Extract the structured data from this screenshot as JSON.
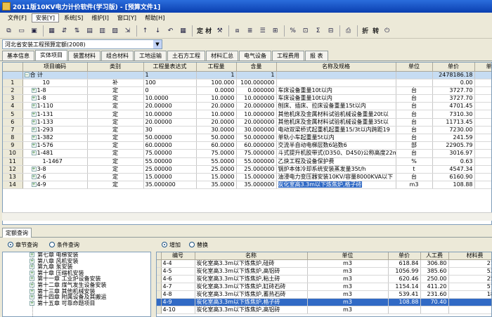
{
  "window": {
    "title": "2011版10KV电力计价软件(学习版) - [预算文件1]"
  },
  "menu": [
    "文件[F]",
    "安装[Y]",
    "系统[S]",
    "维护[I]",
    "窗口[Y]",
    "帮助[H]"
  ],
  "toolbar": {
    "text1": "定 材",
    "text2": "折",
    "text3": "转"
  },
  "quota_select": {
    "value": "河北省安装工程预算定额(2008)"
  },
  "tabs": [
    "基本信息",
    "实体项目",
    "装置材料",
    "组合材料",
    "工地运输",
    "土石方工程",
    "材料汇总",
    "电气设备",
    "工程费用",
    "报 表"
  ],
  "grid": {
    "headers": [
      "",
      "项目编码",
      "类别",
      "工程量表达式",
      "工程量",
      "含量",
      "名称及规格",
      "单位",
      "单价",
      "单价"
    ],
    "total": {
      "code": "合 计",
      "expr": "1",
      "qty": "1",
      "content": "1",
      "price": "2478186.18"
    },
    "rows": [
      {
        "n": "1",
        "tree": false,
        "code": "10",
        "type": "补",
        "expr": "100",
        "qty": "100.000",
        "content": "100.000000",
        "name": "",
        "unit": "",
        "price": "0.00"
      },
      {
        "n": "2",
        "tree": true,
        "code": "1-8",
        "type": "定",
        "expr": "0",
        "qty": "0.0000",
        "content": "0.000000",
        "name": "车床设备重量10t以内",
        "unit": "台",
        "price": "3727.70"
      },
      {
        "n": "3",
        "tree": true,
        "code": "1-8",
        "type": "定",
        "expr": "10.0000",
        "qty": "10.0000",
        "content": "10.000000",
        "name": "车床设备重量10t以内",
        "unit": "台",
        "price": "3727.70"
      },
      {
        "n": "4",
        "tree": true,
        "code": "1-110",
        "type": "定",
        "expr": "20.00000",
        "qty": "20.0000",
        "content": "20.000000",
        "name": "刨床、插床、拉床设备重量15t以内",
        "unit": "台",
        "price": "4701.45"
      },
      {
        "n": "5",
        "tree": true,
        "code": "1-131",
        "type": "定",
        "expr": "10.00000",
        "qty": "10.0000",
        "content": "10.000000",
        "name": "其他机床及金属材料试验机械设备重量20t以",
        "unit": "台",
        "price": "7310.30"
      },
      {
        "n": "6",
        "tree": true,
        "code": "1-133",
        "type": "定",
        "expr": "20.00000",
        "qty": "20.0000",
        "content": "20.000000",
        "name": "其他机床及金属材料试验机械设备重量35t以",
        "unit": "台",
        "price": "11713.45"
      },
      {
        "n": "7",
        "tree": true,
        "code": "1-293",
        "type": "定",
        "expr": "30",
        "qty": "30.0000",
        "content": "30.000000",
        "name": "电动双梁桥式起重机起重量15/3t以内跨距19",
        "unit": "台",
        "price": "7230.00"
      },
      {
        "n": "8",
        "tree": true,
        "code": "1-382",
        "type": "定",
        "expr": "50.00000",
        "qty": "50.0000",
        "content": "50.000000",
        "name": "单轨小车起重量5t以内",
        "unit": "台",
        "price": "241.59"
      },
      {
        "n": "9",
        "tree": true,
        "code": "1-576",
        "type": "定",
        "expr": "60.00000",
        "qty": "60.0000",
        "content": "60.000000",
        "name": "交流半自动电梯层数6站数6",
        "unit": "部",
        "price": "22905.79"
      },
      {
        "n": "10",
        "tree": true,
        "code": "1-481",
        "type": "定",
        "expr": "75.00000",
        "qty": "75.0000",
        "content": "75.000000",
        "name": "斗式提升机胶带式(D350、D450)公称高度22m",
        "unit": "台",
        "price": "3016.97"
      },
      {
        "n": "11",
        "tree": false,
        "code": "1-1467",
        "type": "定",
        "expr": "55.00000",
        "qty": "55.0000",
        "content": "55.000000",
        "name": "乙炔工程及设备保护费",
        "unit": "%",
        "price": "0.63"
      },
      {
        "n": "12",
        "tree": true,
        "code": "3-8",
        "type": "定",
        "expr": "25.00000",
        "qty": "25.0000",
        "content": "25.000000",
        "name": "锅炉本体冷却系统安装蒸发量35t/h",
        "unit": "t",
        "price": "4547.34"
      },
      {
        "n": "13",
        "tree": true,
        "code": "2-6",
        "type": "定",
        "expr": "15.00000",
        "qty": "15.0000",
        "content": "15.000000",
        "name": "油浸电力变压器安装10KV/容量8000KVA以下",
        "unit": "台",
        "price": "6160.90"
      },
      {
        "n": "14",
        "tree": true,
        "code": "4-9",
        "type": "定",
        "expr": "35.000000",
        "qty": "35.0000",
        "content": "35.000000",
        "name": "炭化室高3.3m以下炼焦炉,格子砖",
        "unit": "m3",
        "price": "108.88",
        "highlight": true
      }
    ]
  },
  "bottom": {
    "tab": "定额查询",
    "radio_left": [
      "章节查询",
      "条件查询"
    ],
    "radio_right": [
      "增加",
      "替换"
    ],
    "tree": [
      "第七章 电梯安装",
      "第八章 风机安装",
      "第九章 泵安装",
      "第十章 压缩机安装",
      "第十一章 工业炉设备安装",
      "第十二章 煤气发生设备安装",
      "第十三章 其他机械安装",
      "第十四章 附属设备及其搬运",
      "第十五章 可靠命题项目"
    ],
    "headers": [
      "",
      "编号",
      "名称",
      "单位",
      "单价",
      "人工费",
      "材料费"
    ],
    "rows": [
      {
        "code": "4-4",
        "name": "炭化室高3.3m以下炼焦炉,硅砖",
        "unit": "m3",
        "price": "618.84",
        "labor": "306.80",
        "mat": "215."
      },
      {
        "code": "4-5",
        "name": "炭化室高3.3m以下炼焦炉,高铝砖",
        "unit": "m3",
        "price": "1056.99",
        "labor": "385.60",
        "mat": "529."
      },
      {
        "code": "4-6",
        "name": "炭化室高3.3m以下炼焦炉,粘土砖",
        "unit": "m3",
        "price": "620.46",
        "labor": "250.00",
        "mat": "254."
      },
      {
        "code": "4-7",
        "name": "炭化室高3.3m以下炼焦炉,缸砖石砖",
        "unit": "m3",
        "price": "1154.14",
        "labor": "411.20",
        "mat": "579."
      },
      {
        "code": "4-8",
        "name": "炭化室高3.3m以下炼焦炉,蓄热石砖",
        "unit": "m3",
        "price": "539.41",
        "labor": "231.60",
        "mat": "180."
      },
      {
        "code": "4-9",
        "name": "炭化室高3.3m以下炼焦炉,格子砖",
        "unit": "m3",
        "price": "108.88",
        "labor": "70.40",
        "mat": "4.",
        "selected": true
      },
      {
        "code": "4-10",
        "name": "炭化室高3.3m以下炼焦炉,高铝砖",
        "unit": "m3",
        "price": "",
        "labor": "",
        "mat": ""
      }
    ]
  }
}
